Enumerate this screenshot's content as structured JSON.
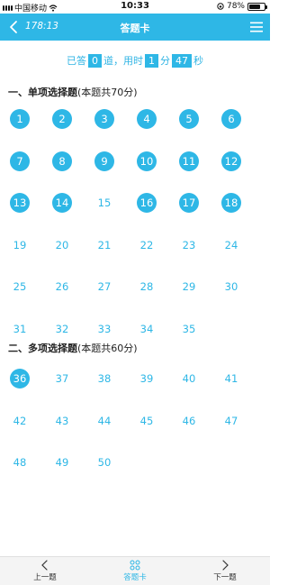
{
  "status_bar": {
    "carrier": "中国移动",
    "time": "10:33",
    "battery": "78%",
    "battery_level": 0.78
  },
  "nav": {
    "counter": "178:13",
    "title": "答题卡",
    "icons": {
      "back": "chevron-left-icon",
      "menu": "hamburger-menu-icon"
    }
  },
  "summary": {
    "prefix": "已答",
    "answered": "0",
    "mid": "道，用时",
    "minutes": "1",
    "min_unit": "分",
    "seconds": "47",
    "sec_unit": "秒"
  },
  "sections": [
    {
      "title": "一、单项选择题",
      "note": "(本题共70分)",
      "questions": [
        {
          "n": "1",
          "answered": true
        },
        {
          "n": "2",
          "answered": true
        },
        {
          "n": "3",
          "answered": true
        },
        {
          "n": "4",
          "answered": true
        },
        {
          "n": "5",
          "answered": true
        },
        {
          "n": "6",
          "answered": true
        },
        {
          "n": "7",
          "answered": true
        },
        {
          "n": "8",
          "answered": true
        },
        {
          "n": "9",
          "answered": true
        },
        {
          "n": "10",
          "answered": true
        },
        {
          "n": "11",
          "answered": true
        },
        {
          "n": "12",
          "answered": true
        },
        {
          "n": "13",
          "answered": true
        },
        {
          "n": "14",
          "answered": true
        },
        {
          "n": "15",
          "answered": false
        },
        {
          "n": "16",
          "answered": true
        },
        {
          "n": "17",
          "answered": true
        },
        {
          "n": "18",
          "answered": true
        },
        {
          "n": "19",
          "answered": false
        },
        {
          "n": "20",
          "answered": false
        },
        {
          "n": "21",
          "answered": false
        },
        {
          "n": "22",
          "answered": false
        },
        {
          "n": "23",
          "answered": false
        },
        {
          "n": "24",
          "answered": false
        },
        {
          "n": "25",
          "answered": false
        },
        {
          "n": "26",
          "answered": false
        },
        {
          "n": "27",
          "answered": false
        },
        {
          "n": "28",
          "answered": false
        },
        {
          "n": "29",
          "answered": false
        },
        {
          "n": "30",
          "answered": false
        },
        {
          "n": "31",
          "answered": false
        },
        {
          "n": "32",
          "answered": false
        },
        {
          "n": "33",
          "answered": false
        },
        {
          "n": "34",
          "answered": false
        },
        {
          "n": "35",
          "answered": false
        }
      ]
    },
    {
      "title": "二、多项选择题",
      "note": "(本题共60分)",
      "questions": [
        {
          "n": "36",
          "answered": true
        },
        {
          "n": "37",
          "answered": false
        },
        {
          "n": "38",
          "answered": false
        },
        {
          "n": "39",
          "answered": false
        },
        {
          "n": "40",
          "answered": false
        },
        {
          "n": "41",
          "answered": false
        },
        {
          "n": "42",
          "answered": false
        },
        {
          "n": "43",
          "answered": false
        },
        {
          "n": "44",
          "answered": false
        },
        {
          "n": "45",
          "answered": false
        },
        {
          "n": "46",
          "answered": false
        },
        {
          "n": "47",
          "answered": false
        },
        {
          "n": "48",
          "answered": false
        },
        {
          "n": "49",
          "answered": false
        },
        {
          "n": "50",
          "answered": false
        }
      ]
    }
  ],
  "bottom_bar": {
    "prev_label": "上一题",
    "card_label": "答题卡",
    "next_label": "下一题",
    "icons": {
      "prev": "chevron-left-icon",
      "card": "grid-card-icon",
      "next": "chevron-right-icon"
    }
  },
  "colors": {
    "accent": "#2eb7e6",
    "text": "#222222",
    "bottom_bg": "#f4f4f4"
  }
}
